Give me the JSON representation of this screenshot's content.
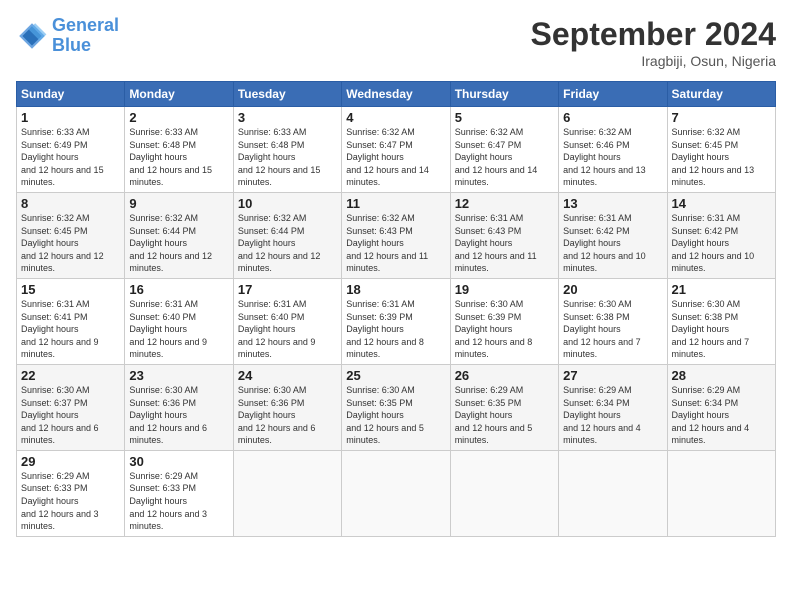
{
  "header": {
    "logo_general": "General",
    "logo_blue": "Blue",
    "month_title": "September 2024",
    "location": "Iragbiji, Osun, Nigeria"
  },
  "days_of_week": [
    "Sunday",
    "Monday",
    "Tuesday",
    "Wednesday",
    "Thursday",
    "Friday",
    "Saturday"
  ],
  "weeks": [
    [
      {
        "day": "1",
        "sunrise": "6:33 AM",
        "sunset": "6:49 PM",
        "daylight": "12 hours and 15 minutes."
      },
      {
        "day": "2",
        "sunrise": "6:33 AM",
        "sunset": "6:48 PM",
        "daylight": "12 hours and 15 minutes."
      },
      {
        "day": "3",
        "sunrise": "6:33 AM",
        "sunset": "6:48 PM",
        "daylight": "12 hours and 15 minutes."
      },
      {
        "day": "4",
        "sunrise": "6:32 AM",
        "sunset": "6:47 PM",
        "daylight": "12 hours and 14 minutes."
      },
      {
        "day": "5",
        "sunrise": "6:32 AM",
        "sunset": "6:47 PM",
        "daylight": "12 hours and 14 minutes."
      },
      {
        "day": "6",
        "sunrise": "6:32 AM",
        "sunset": "6:46 PM",
        "daylight": "12 hours and 13 minutes."
      },
      {
        "day": "7",
        "sunrise": "6:32 AM",
        "sunset": "6:45 PM",
        "daylight": "12 hours and 13 minutes."
      }
    ],
    [
      {
        "day": "8",
        "sunrise": "6:32 AM",
        "sunset": "6:45 PM",
        "daylight": "12 hours and 12 minutes."
      },
      {
        "day": "9",
        "sunrise": "6:32 AM",
        "sunset": "6:44 PM",
        "daylight": "12 hours and 12 minutes."
      },
      {
        "day": "10",
        "sunrise": "6:32 AM",
        "sunset": "6:44 PM",
        "daylight": "12 hours and 12 minutes."
      },
      {
        "day": "11",
        "sunrise": "6:32 AM",
        "sunset": "6:43 PM",
        "daylight": "12 hours and 11 minutes."
      },
      {
        "day": "12",
        "sunrise": "6:31 AM",
        "sunset": "6:43 PM",
        "daylight": "12 hours and 11 minutes."
      },
      {
        "day": "13",
        "sunrise": "6:31 AM",
        "sunset": "6:42 PM",
        "daylight": "12 hours and 10 minutes."
      },
      {
        "day": "14",
        "sunrise": "6:31 AM",
        "sunset": "6:42 PM",
        "daylight": "12 hours and 10 minutes."
      }
    ],
    [
      {
        "day": "15",
        "sunrise": "6:31 AM",
        "sunset": "6:41 PM",
        "daylight": "12 hours and 9 minutes."
      },
      {
        "day": "16",
        "sunrise": "6:31 AM",
        "sunset": "6:40 PM",
        "daylight": "12 hours and 9 minutes."
      },
      {
        "day": "17",
        "sunrise": "6:31 AM",
        "sunset": "6:40 PM",
        "daylight": "12 hours and 9 minutes."
      },
      {
        "day": "18",
        "sunrise": "6:31 AM",
        "sunset": "6:39 PM",
        "daylight": "12 hours and 8 minutes."
      },
      {
        "day": "19",
        "sunrise": "6:30 AM",
        "sunset": "6:39 PM",
        "daylight": "12 hours and 8 minutes."
      },
      {
        "day": "20",
        "sunrise": "6:30 AM",
        "sunset": "6:38 PM",
        "daylight": "12 hours and 7 minutes."
      },
      {
        "day": "21",
        "sunrise": "6:30 AM",
        "sunset": "6:38 PM",
        "daylight": "12 hours and 7 minutes."
      }
    ],
    [
      {
        "day": "22",
        "sunrise": "6:30 AM",
        "sunset": "6:37 PM",
        "daylight": "12 hours and 6 minutes."
      },
      {
        "day": "23",
        "sunrise": "6:30 AM",
        "sunset": "6:36 PM",
        "daylight": "12 hours and 6 minutes."
      },
      {
        "day": "24",
        "sunrise": "6:30 AM",
        "sunset": "6:36 PM",
        "daylight": "12 hours and 6 minutes."
      },
      {
        "day": "25",
        "sunrise": "6:30 AM",
        "sunset": "6:35 PM",
        "daylight": "12 hours and 5 minutes."
      },
      {
        "day": "26",
        "sunrise": "6:29 AM",
        "sunset": "6:35 PM",
        "daylight": "12 hours and 5 minutes."
      },
      {
        "day": "27",
        "sunrise": "6:29 AM",
        "sunset": "6:34 PM",
        "daylight": "12 hours and 4 minutes."
      },
      {
        "day": "28",
        "sunrise": "6:29 AM",
        "sunset": "6:34 PM",
        "daylight": "12 hours and 4 minutes."
      }
    ],
    [
      {
        "day": "29",
        "sunrise": "6:29 AM",
        "sunset": "6:33 PM",
        "daylight": "12 hours and 3 minutes."
      },
      {
        "day": "30",
        "sunrise": "6:29 AM",
        "sunset": "6:33 PM",
        "daylight": "12 hours and 3 minutes."
      },
      null,
      null,
      null,
      null,
      null
    ]
  ]
}
